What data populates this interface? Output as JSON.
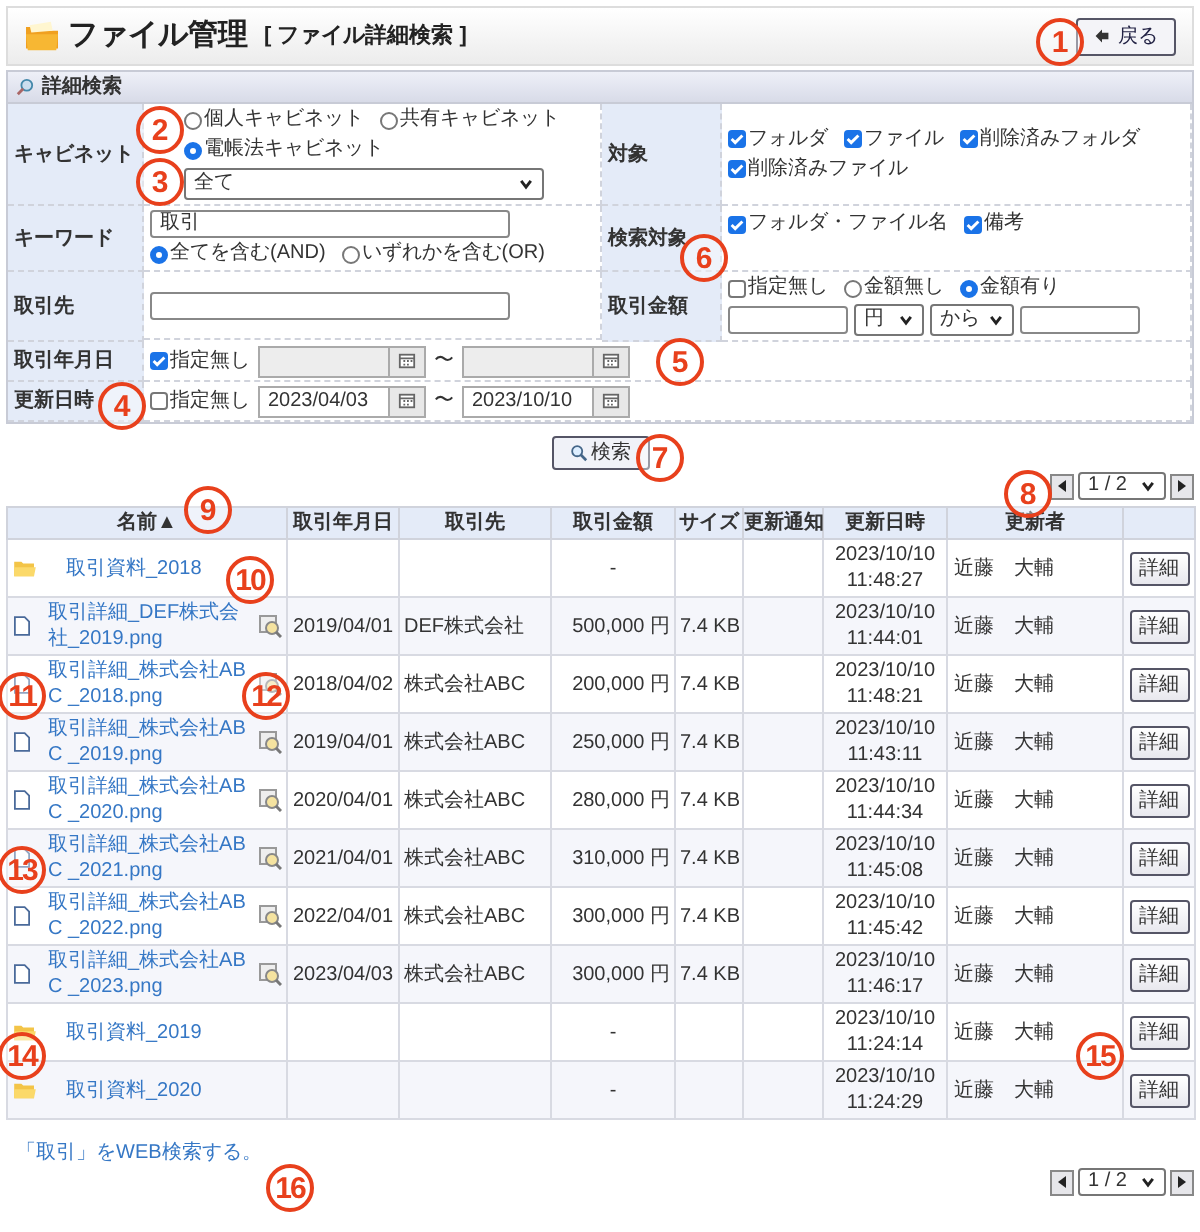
{
  "header": {
    "title": "ファイル管理",
    "subtitle": "[ ファイル詳細検索 ]",
    "back_button": "戻る"
  },
  "search": {
    "title": "詳細検索",
    "cabinet": {
      "label": "キャビネット",
      "options": [
        {
          "label": "個人キャビネット",
          "selected": false
        },
        {
          "label": "共有キャビネット",
          "selected": false
        },
        {
          "label": "電帳法キャビネット",
          "selected": true
        }
      ],
      "select": "全て"
    },
    "target": {
      "label": "対象",
      "options": [
        {
          "label": "フォルダ",
          "checked": true
        },
        {
          "label": "ファイル",
          "checked": true
        },
        {
          "label": "削除済みフォルダ",
          "checked": true
        },
        {
          "label": "削除済みファイル",
          "checked": true
        }
      ]
    },
    "keyword": {
      "label": "キーワード",
      "value": "取引",
      "modes": [
        {
          "label": "全てを含む(AND)",
          "selected": true
        },
        {
          "label": "いずれかを含む(OR)",
          "selected": false
        }
      ]
    },
    "search_target": {
      "label": "検索対象",
      "options": [
        {
          "label": "フォルダ・ファイル名",
          "checked": true
        },
        {
          "label": "備考",
          "checked": true
        }
      ]
    },
    "partner": {
      "label": "取引先"
    },
    "amount": {
      "label": "取引金額",
      "unspecified": {
        "label": "指定無し",
        "checked": false
      },
      "modes": [
        {
          "label": "金額無し",
          "selected": false
        },
        {
          "label": "金額有り",
          "selected": true
        }
      ],
      "unit": "円",
      "range": "から"
    },
    "trade_date": {
      "label": "取引年月日",
      "unspecified": {
        "label": "指定無し",
        "checked": true
      },
      "separator": "〜"
    },
    "updated": {
      "label": "更新日時",
      "unspecified": {
        "label": "指定無し",
        "checked": false
      },
      "from": "2023/04/03",
      "separator": "〜",
      "to": "2023/10/10"
    },
    "button": "検索"
  },
  "pager_top": {
    "page": "1 / 2"
  },
  "table": {
    "columns": [
      "名前▲",
      "取引年月日",
      "取引先",
      "取引金額",
      "サイズ",
      "更新通知",
      "更新日時",
      "更新者"
    ],
    "rows": [
      {
        "kind": "folder",
        "name": "取引資料_2018",
        "date": "",
        "partner": "",
        "amount": "-",
        "size": "",
        "updated": [
          "2023/10/10",
          "11:48:27"
        ],
        "user": "近藤　大輔",
        "action": "詳細"
      },
      {
        "kind": "file",
        "name": "取引詳細_DEF株式会社_2019.png",
        "date": "2019/04/01",
        "partner": "DEF株式会社",
        "amount": "500,000 円",
        "size": "7.4 KB",
        "updated": [
          "2023/10/10",
          "11:44:01"
        ],
        "user": "近藤　大輔",
        "action": "詳細"
      },
      {
        "kind": "file",
        "name": "取引詳細_株式会社ABC _2018.png",
        "date": "2018/04/02",
        "partner": "株式会社ABC",
        "amount": "200,000 円",
        "size": "7.4 KB",
        "updated": [
          "2023/10/10",
          "11:48:21"
        ],
        "user": "近藤　大輔",
        "action": "詳細"
      },
      {
        "kind": "file",
        "name": "取引詳細_株式会社ABC _2019.png",
        "date": "2019/04/01",
        "partner": "株式会社ABC",
        "amount": "250,000 円",
        "size": "7.4 KB",
        "updated": [
          "2023/10/10",
          "11:43:11"
        ],
        "user": "近藤　大輔",
        "action": "詳細"
      },
      {
        "kind": "file",
        "name": "取引詳細_株式会社ABC _2020.png",
        "date": "2020/04/01",
        "partner": "株式会社ABC",
        "amount": "280,000 円",
        "size": "7.4 KB",
        "updated": [
          "2023/10/10",
          "11:44:34"
        ],
        "user": "近藤　大輔",
        "action": "詳細"
      },
      {
        "kind": "file",
        "name": "取引詳細_株式会社ABC _2021.png",
        "date": "2021/04/01",
        "partner": "株式会社ABC",
        "amount": "310,000 円",
        "size": "7.4 KB",
        "updated": [
          "2023/10/10",
          "11:45:08"
        ],
        "user": "近藤　大輔",
        "action": "詳細"
      },
      {
        "kind": "file",
        "name": "取引詳細_株式会社ABC _2022.png",
        "date": "2022/04/01",
        "partner": "株式会社ABC",
        "amount": "300,000 円",
        "size": "7.4 KB",
        "updated": [
          "2023/10/10",
          "11:45:42"
        ],
        "user": "近藤　大輔",
        "action": "詳細"
      },
      {
        "kind": "file",
        "name": "取引詳細_株式会社ABC _2023.png",
        "date": "2023/04/03",
        "partner": "株式会社ABC",
        "amount": "300,000 円",
        "size": "7.4 KB",
        "updated": [
          "2023/10/10",
          "11:46:17"
        ],
        "user": "近藤　大輔",
        "action": "詳細"
      },
      {
        "kind": "folder",
        "name": "取引資料_2019",
        "date": "",
        "partner": "",
        "amount": "-",
        "size": "",
        "updated": [
          "2023/10/10",
          "11:24:14"
        ],
        "user": "近藤　大輔",
        "action": "詳細"
      },
      {
        "kind": "folder",
        "name": "取引資料_2020",
        "date": "",
        "partner": "",
        "amount": "-",
        "size": "",
        "updated": [
          "2023/10/10",
          "11:24:29"
        ],
        "user": "近藤　大輔",
        "action": "詳細"
      }
    ]
  },
  "web_search_link": "「取引」をWEB検索する。",
  "pager_bottom": {
    "page": "1 / 2"
  },
  "callouts": [
    "1",
    "2",
    "3",
    "4",
    "5",
    "6",
    "7",
    "8",
    "9",
    "10",
    "11",
    "12",
    "13",
    "14",
    "15",
    "16"
  ]
}
